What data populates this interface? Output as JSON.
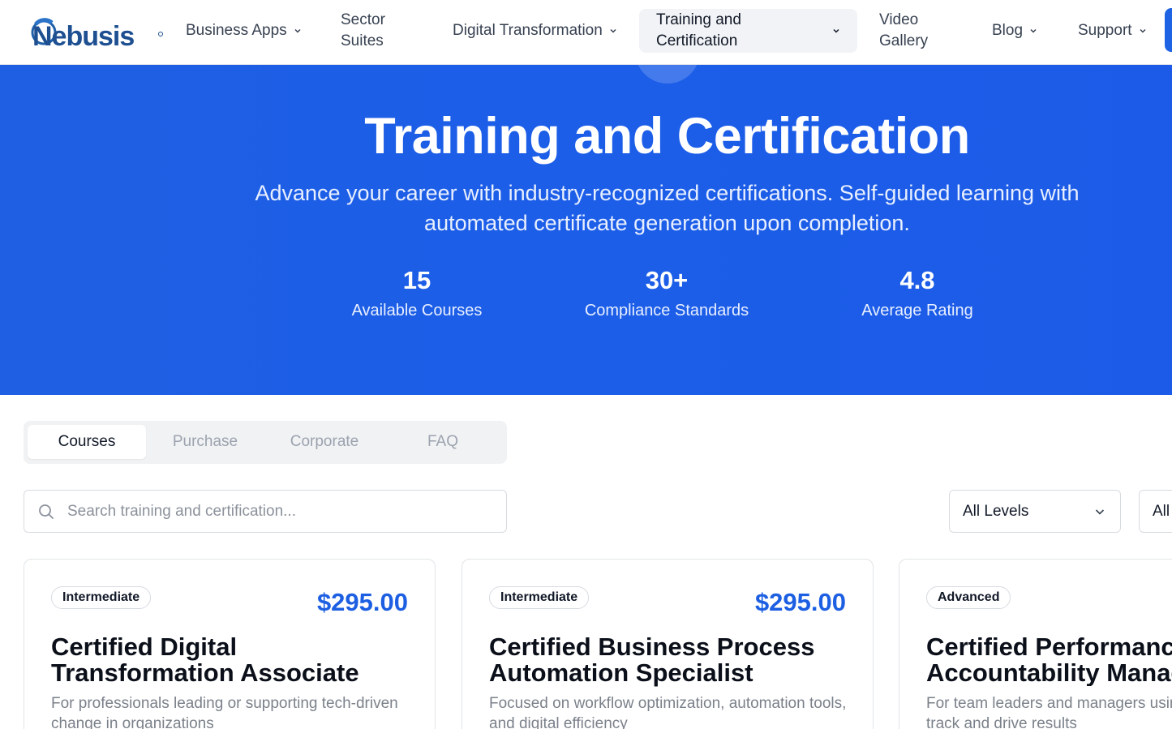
{
  "brand": {
    "name": "Nebusis"
  },
  "nav": {
    "items": [
      {
        "label": "Business Apps",
        "has_dropdown": true
      },
      {
        "label": "Sector\nSuites",
        "has_dropdown": false
      },
      {
        "label": "Digital Transformation",
        "has_dropdown": true
      },
      {
        "label": "Training and Certification",
        "has_dropdown": true,
        "active": true
      },
      {
        "label": "Video\nGallery",
        "has_dropdown": false
      },
      {
        "label": "Blog",
        "has_dropdown": true
      },
      {
        "label": "Support",
        "has_dropdown": true
      }
    ]
  },
  "hero": {
    "title": "Training and Certification",
    "subtitle": "Advance your career with industry-recognized certifications. Self-guided learning with automated certificate generation upon completion.",
    "stats": [
      {
        "value": "15",
        "label": "Available Courses"
      },
      {
        "value": "30+",
        "label": "Compliance Standards"
      },
      {
        "value": "4.8",
        "label": "Average Rating"
      }
    ]
  },
  "tabs": [
    {
      "label": "Courses",
      "active": true
    },
    {
      "label": "Purchase",
      "active": false
    },
    {
      "label": "Corporate",
      "active": false
    },
    {
      "label": "FAQ",
      "active": false
    }
  ],
  "search": {
    "placeholder": "Search training and certification...",
    "value": ""
  },
  "filters": {
    "level": "All Levels",
    "second": "All"
  },
  "courses": [
    {
      "level": "Intermediate",
      "price": "$295.00",
      "title_line1": "Certified Digital",
      "title_line2": "Transformation Associate",
      "desc_line1": "For professionals leading or supporting tech-driven",
      "desc_line2": "change in organizations"
    },
    {
      "level": "Intermediate",
      "price": "$295.00",
      "title_line1": "Certified Business Process",
      "title_line2": "Automation Specialist",
      "desc_line1": "Focused on workflow optimization, automation tools,",
      "desc_line2": "and digital efficiency"
    },
    {
      "level": "Advanced",
      "price": "",
      "title_line1": "Certified Performance",
      "title_line2": "Accountability Manag",
      "desc_line1": "For team leaders and managers usin",
      "desc_line2": "track and drive results"
    }
  ],
  "colors": {
    "accent": "#1d5fe2",
    "hero_bg": "#1e5fe3",
    "muted_text": "#7b818a"
  }
}
